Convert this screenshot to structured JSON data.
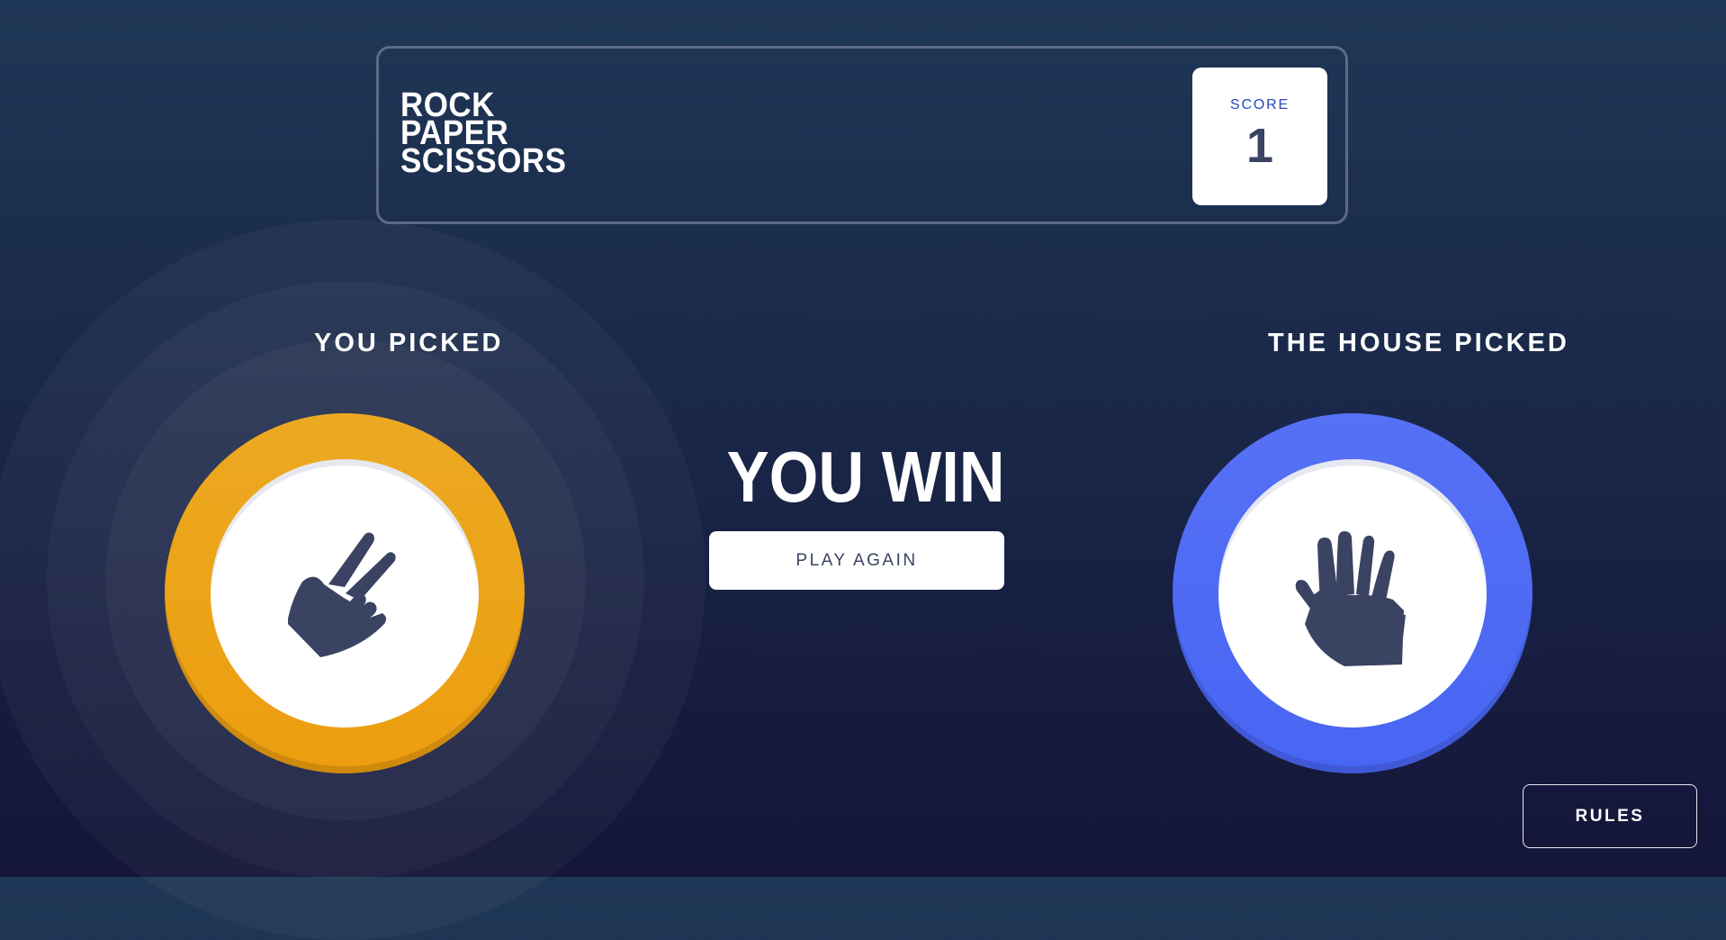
{
  "header": {
    "logo_lines": [
      "ROCK",
      "PAPER",
      "SCISSORS"
    ],
    "score_label": "SCORE",
    "score_value": "1"
  },
  "result": {
    "player_heading": "YOU PICKED",
    "house_heading": "THE HOUSE PICKED",
    "player_pick": "scissors",
    "house_pick": "paper",
    "outcome_text": "YOU WIN",
    "play_again_label": "PLAY AGAIN"
  },
  "footer": {
    "rules_label": "RULES"
  },
  "icons": {
    "player": "scissors-icon",
    "house": "paper-icon"
  },
  "colors": {
    "background_top": "#1f3756",
    "background_bottom": "#141539",
    "scissors_ring": "#ec9e0e",
    "paper_ring": "#4865f4",
    "score_label": "#2a46c0",
    "dark_text": "#3b4363",
    "header_outline": "#5c6b86"
  }
}
